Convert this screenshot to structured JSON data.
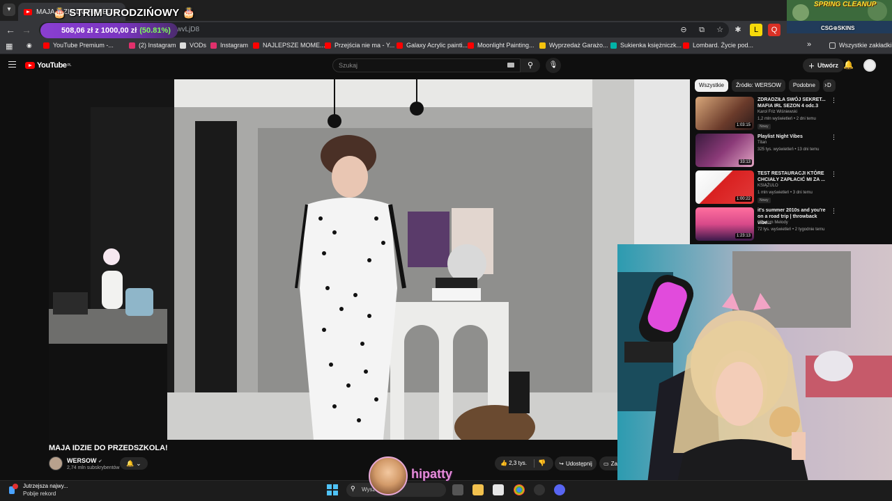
{
  "browser": {
    "tab_title": "MAJA IDZIE DO PRZEDSZKOL...",
    "tab_close": "✕",
    "url_fragment": "CwvLjD8",
    "bookmarks": [
      {
        "label": "YouTube Premium -...",
        "color": "#ff0000"
      },
      {
        "label": "(2) Instagram",
        "color": "#e1306c"
      },
      {
        "label": "VODs",
        "color": "#dddddd"
      },
      {
        "label": "Instagram",
        "color": "#e1306c"
      },
      {
        "label": "NAJLEPSZE MOME...",
        "color": "#ff0000"
      },
      {
        "label": "Przejścia nie ma - Y...",
        "color": "#ff0000"
      },
      {
        "label": "Galaxy Acrylic painti...",
        "color": "#ff0000"
      },
      {
        "label": "Moonlight Painting...",
        "color": "#ff0000"
      },
      {
        "label": "Wyprzedaż Garażo...",
        "color": "#f4c20d"
      },
      {
        "label": "Sukienka księżniczk...",
        "color": "#00b3a7"
      },
      {
        "label": "Lombard. Życie pod...",
        "color": "#ff0000"
      }
    ],
    "bookmarks_overflow": "»",
    "all_bookmarks": "Wszystkie zakładki"
  },
  "overlay": {
    "stream_title": "🎂 STRIM URODZIŃOWY 🎂",
    "donation_current": "508,06 zł",
    "donation_sep": "z",
    "donation_goal": "1000,00 zł",
    "donation_pct": "(50.81%)",
    "spring_cleanup": "SPRING CLEANUP",
    "csg_skins": "CSG⊕SKINS",
    "chat_user": "hipatty"
  },
  "youtube": {
    "logo_text": "YouTube",
    "logo_region": "PL",
    "search_placeholder": "Szukaj",
    "create_label": "Utwórz",
    "video": {
      "title": "MAJA IDZIE DO PRZEDSZKOLA!",
      "channel": "WERSOW",
      "subscribers": "2,74 mln subskrybentów",
      "likes": "2,3 tys.",
      "share": "Udostępnij",
      "save": "Za"
    },
    "chips": [
      {
        "label": "Wszystkie",
        "active": true
      },
      {
        "label": "Źródło: WERSOW",
        "active": false
      },
      {
        "label": "Podobne",
        "active": false
      },
      {
        "label": "D",
        "active": false
      }
    ],
    "recommendations": [
      {
        "title": "ZDRADZIŁA SWÓJ SEKRET... MAFIA IRL SEZON 4 odc.3",
        "channel": "Karol Friz Wiśniewski",
        "meta": "1,2 mln wyświetleń • 2 dni temu",
        "badge": "Nowy",
        "duration": "1:03:15"
      },
      {
        "title": "Playlist Night Vibes",
        "channel": "Titan",
        "meta": "325 tys. wyświetleń • 13 dni temu",
        "badge": "",
        "duration": "33:13"
      },
      {
        "title": "TEST RESTAURACJI KTÓRE CHCIAŁY ZAPŁACIĆ MI ZA ...",
        "channel": "KSIĄŻULO",
        "meta": "1 mln wyświetleń • 3 dni temu",
        "badge": "Nowy",
        "duration": "1:00:22"
      },
      {
        "title": "it's summer 2010s and you're on a road trip | throwback vibe...",
        "channel": "Random Melody",
        "meta": "72 tys. wyświetleń • 2 tygodnie temu",
        "badge": "",
        "duration": "1:23:13"
      }
    ]
  },
  "taskbar": {
    "notif_title": "Jutrzejsza najwy...",
    "notif_sub": "Pobije rekord",
    "search_placeholder": "Wysz"
  }
}
